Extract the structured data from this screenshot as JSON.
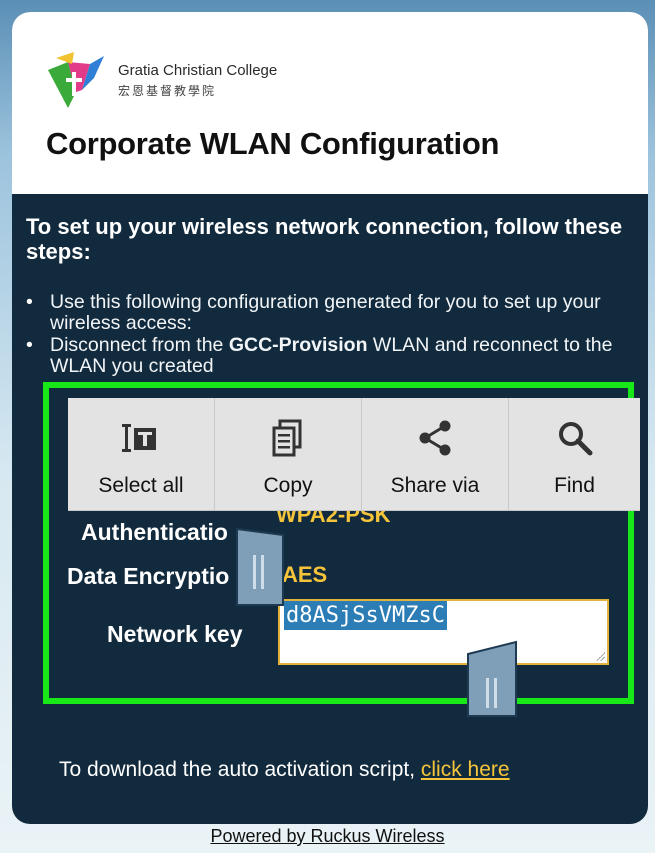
{
  "header": {
    "logo_name_en": "Gratia Christian College",
    "logo_name_zh": "宏恩基督教學院",
    "title": "Corporate WLAN Configuration"
  },
  "instructions": {
    "heading": "To set up your wireless network connection, follow these steps:",
    "step1": "Use this following configuration generated for you to set up your wireless access:",
    "step2_prefix": "Disconnect from the ",
    "step2_bold": "GCC-Provision",
    "step2_suffix": " WLAN and reconnect to the WLAN you created"
  },
  "config": {
    "auth_label": "Authentication",
    "auth_visible": "Authenticatio",
    "auth_value": "WPA2-PSK",
    "encryption_label": "Data Encryption",
    "encryption_visible": "Data Encryptio",
    "encryption_value": "AES",
    "key_label": "Network key",
    "key_value": "d8ASjSsVMZsC"
  },
  "context_menu": [
    {
      "label": "Select all",
      "icon": "select-all-icon"
    },
    {
      "label": "Copy",
      "icon": "copy-icon"
    },
    {
      "label": "Share via",
      "icon": "share-icon"
    },
    {
      "label": "Find",
      "icon": "search-icon"
    }
  ],
  "download": {
    "text": "To download the auto activation script, ",
    "link": "click here"
  },
  "footer": {
    "powered_by": "Powered by Ruckus Wireless"
  },
  "colors": {
    "panel_bg": "#122a3d",
    "accent_yellow": "#f5c43a",
    "highlight_green": "#18e818",
    "selection_blue": "#2c7db5"
  }
}
